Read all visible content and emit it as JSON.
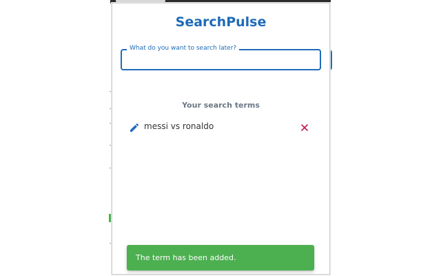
{
  "app": {
    "title": "SearchPulse"
  },
  "search": {
    "label": "What do you want to search later?",
    "value": "",
    "placeholder": ""
  },
  "terms": {
    "heading": "Your search terms",
    "items": [
      {
        "text": "messi vs ronaldo",
        "edit_icon": "pencil-icon",
        "delete_icon": "close-icon"
      }
    ]
  },
  "toast": {
    "message": "The term has been added."
  },
  "colors": {
    "accent": "#1e6bb8",
    "danger": "#c2185b",
    "success": "#4caf50",
    "muted_text": "#6b7785"
  }
}
